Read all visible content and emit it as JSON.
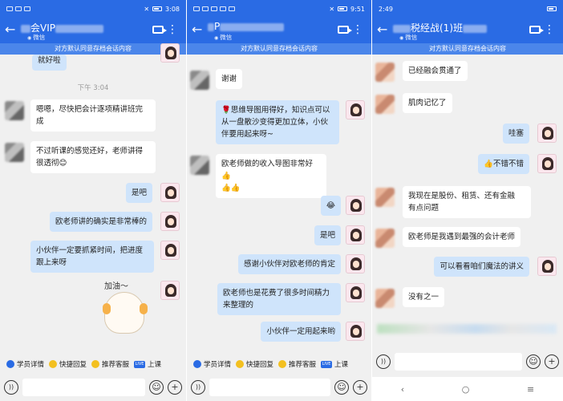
{
  "panels": [
    {
      "status": {
        "time": "3:08"
      },
      "header": {
        "title": "会VIP",
        "subtitle": "微信"
      },
      "notice": "对方默认同意存档会话内容",
      "time_divider": "下午 3:04",
      "messages": [
        {
          "dir": "out",
          "text": "就好啦"
        },
        {
          "dir": "in",
          "text": "嗯嗯，尽快把会计逐项精讲班完\n成"
        },
        {
          "dir": "in",
          "text": "不过听课的感觉还好，老师讲得\n很透彻😊"
        },
        {
          "dir": "out",
          "text": "是吧"
        },
        {
          "dir": "out",
          "text": "欧老师讲的确实是非常棒的"
        },
        {
          "dir": "out",
          "text": "小伙伴一定要抓紧时间，把进度\n跟上来呀"
        }
      ],
      "sticker_caption": "加油～",
      "quick": [
        {
          "icon": "person-icon",
          "label": "学员详情"
        },
        {
          "icon": "quick-reply-icon",
          "label": "快捷回复"
        },
        {
          "icon": "service-icon",
          "label": "推荐客服"
        },
        {
          "icon": "live-icon",
          "label": "上课"
        }
      ]
    },
    {
      "status": {
        "time": "9:51"
      },
      "header": {
        "title": "P",
        "subtitle": "微信"
      },
      "notice": "对方默认同意存档会话内容",
      "messages": [
        {
          "dir": "in",
          "text": "谢谢"
        },
        {
          "dir": "out",
          "text": "🌹思维导图用得好，知识点可以\n从一盘散沙变得更加立体，小伙\n伴要用起来呀~"
        },
        {
          "dir": "in",
          "text": "欧老师做的收入导图非常好👍\n👍👍"
        },
        {
          "dir": "out",
          "text": "😂"
        },
        {
          "dir": "out",
          "text": "是吧"
        },
        {
          "dir": "out",
          "text": "感谢小伙伴对欧老师的肯定"
        },
        {
          "dir": "out",
          "text": "欧老师也是花费了很多时间精力\n来整理的"
        },
        {
          "dir": "out",
          "text": "小伙伴一定用起来哟"
        }
      ],
      "quick": [
        {
          "icon": "person-icon",
          "label": "学员详情"
        },
        {
          "icon": "quick-reply-icon",
          "label": "快捷回复"
        },
        {
          "icon": "service-icon",
          "label": "推荐客服"
        },
        {
          "icon": "live-icon",
          "label": "上课"
        }
      ]
    },
    {
      "status": {
        "time": "2:49"
      },
      "header": {
        "title": "税经战(1)班",
        "subtitle": "微信"
      },
      "notice": "对方默认同意存档会话内容",
      "messages": [
        {
          "dir": "in",
          "text": "已经融会贯通了"
        },
        {
          "dir": "in",
          "text": "肌肉记忆了"
        },
        {
          "dir": "out",
          "text": "哇塞"
        },
        {
          "dir": "out",
          "text": "👍不错不错"
        },
        {
          "dir": "in",
          "text": "我现在是股份、租赁、还有金融\n有点问题"
        },
        {
          "dir": "in",
          "text": "欧老师是我遇到最强的会计老师"
        },
        {
          "dir": "out",
          "text": "可以看看咱们魔法的讲义"
        },
        {
          "dir": "in",
          "text": "没有之一"
        }
      ],
      "nav": {
        "back": "‹",
        "home": "○",
        "recent": "≡"
      }
    }
  ],
  "colors": {
    "brand": "#2a6be4",
    "notice": "#4b86ea",
    "bubble_out": "#cfe4fb",
    "bubble_in": "#ffffff",
    "background": "#f0f0f0"
  }
}
